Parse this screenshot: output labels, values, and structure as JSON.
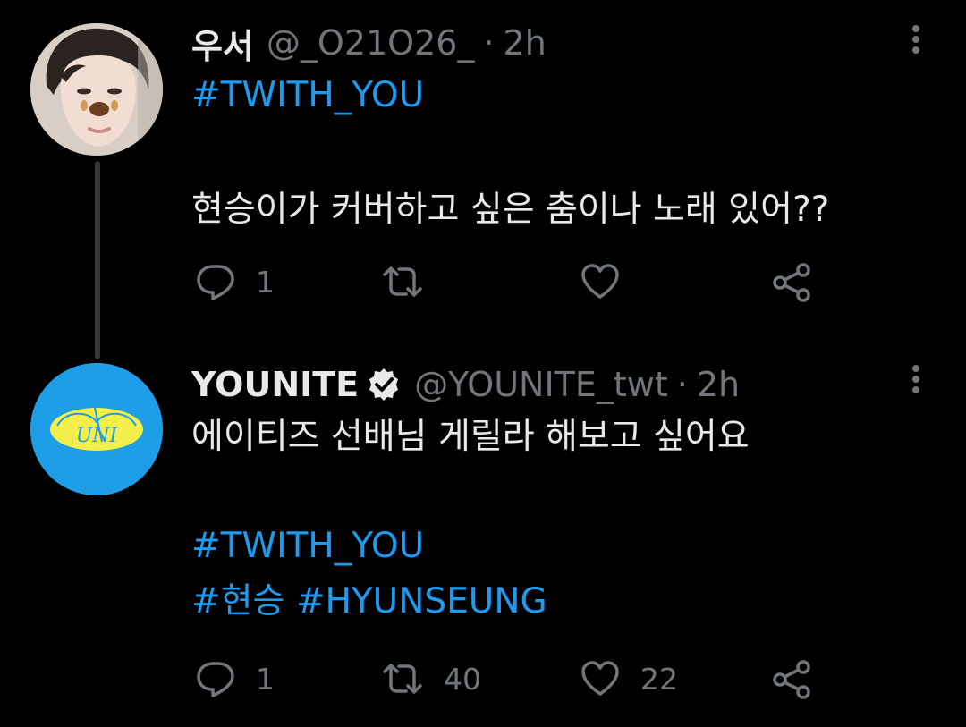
{
  "tweets": [
    {
      "display_name": "우서",
      "handle": "@_O21O26_",
      "separator": "·",
      "time": "2h",
      "avatar": "user-photo-avatar",
      "lines": [
        {
          "text": "#TWITH_YOU",
          "kind": "hashtag"
        },
        {
          "text": "",
          "kind": "blank"
        },
        {
          "text": "현승이가 커버하고 싶은 춤이나 노래 있어??",
          "kind": "text"
        }
      ],
      "actions": {
        "reply": {
          "icon": "reply-icon",
          "count": "1"
        },
        "retweet": {
          "icon": "retweet-icon",
          "count": ""
        },
        "like": {
          "icon": "heart-icon",
          "count": ""
        },
        "share": {
          "icon": "share-icon"
        }
      }
    },
    {
      "display_name": "YOUNITE",
      "verified": true,
      "handle": "@YOUNITE_twt",
      "separator": "·",
      "time": "2h",
      "avatar": "younite-logo-avatar",
      "logo_text": "UNI",
      "lines": [
        {
          "text": "에이티즈 선배님 게릴라 해보고 싶어요",
          "kind": "text"
        },
        {
          "text": "",
          "kind": "blank"
        },
        {
          "text": "#TWITH_YOU",
          "kind": "hashtag"
        },
        {
          "text_1": "#현승",
          "text_2": "#HYUNSEUNG",
          "kind": "hashtag"
        }
      ],
      "actions": {
        "reply": {
          "icon": "reply-icon",
          "count": "1"
        },
        "retweet": {
          "icon": "retweet-icon",
          "count": "40"
        },
        "like": {
          "icon": "heart-icon",
          "count": "22"
        },
        "share": {
          "icon": "share-icon"
        }
      }
    }
  ],
  "colors": {
    "background": "#000000",
    "text": "#e7e9ea",
    "secondary": "#71767b",
    "link": "#1d9bf0",
    "thread_line": "#333639",
    "younite_blue": "#1e9ee6",
    "younite_yellow": "#f2ee4a"
  }
}
